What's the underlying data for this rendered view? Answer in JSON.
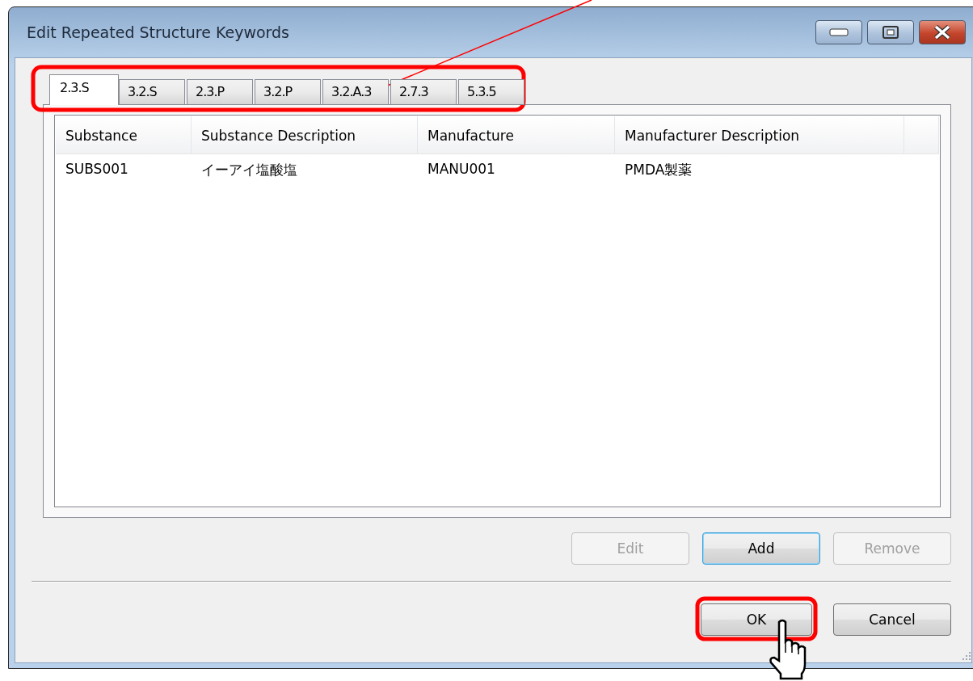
{
  "window": {
    "title": "Edit Repeated Structure Keywords"
  },
  "tabs": [
    {
      "label": "2.3.S",
      "selected": true
    },
    {
      "label": "3.2.S",
      "selected": false
    },
    {
      "label": "2.3.P",
      "selected": false
    },
    {
      "label": "3.2.P",
      "selected": false
    },
    {
      "label": "3.2.A.3",
      "selected": false
    },
    {
      "label": "2.7.3",
      "selected": false
    },
    {
      "label": "5.3.5",
      "selected": false
    }
  ],
  "table": {
    "columns": [
      "Substance",
      "Substance Description",
      "Manufacture",
      "Manufacturer Description"
    ],
    "rows": [
      [
        "SUBS001",
        "イーアイ塩酸塩",
        "MANU001",
        "PMDA製薬"
      ]
    ]
  },
  "row_buttons": [
    {
      "label": "Edit",
      "disabled": true,
      "focused": false
    },
    {
      "label": "Add",
      "disabled": false,
      "focused": true
    },
    {
      "label": "Remove",
      "disabled": true,
      "focused": false
    }
  ],
  "dialog_buttons": [
    {
      "label": "OK",
      "disabled": false,
      "focused": false
    },
    {
      "label": "Cancel",
      "disabled": false,
      "focused": false
    }
  ]
}
